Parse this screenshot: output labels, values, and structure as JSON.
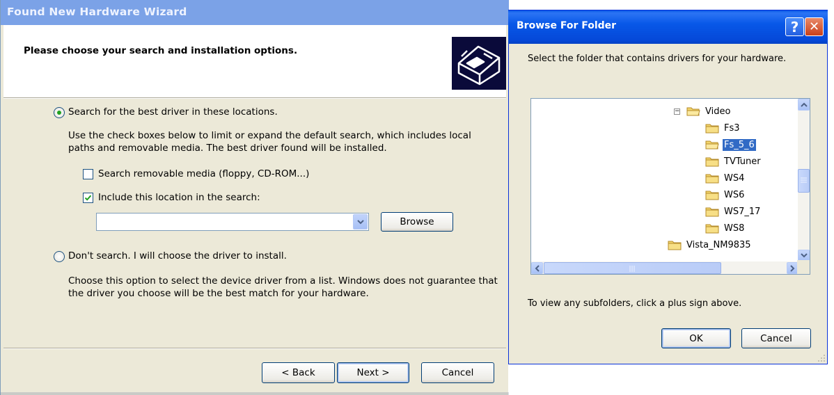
{
  "wizard": {
    "title": "Found New Hardware Wizard",
    "heading": "Please choose your search and installation options.",
    "option_search": {
      "label": "Search for the best driver in these locations.",
      "checked": true,
      "description": "Use the check boxes below to limit or expand the default search, which includes local paths and removable media. The best driver found will be installed.",
      "removable_media": {
        "label": "Search removable media (floppy, CD-ROM...)",
        "checked": false
      },
      "include_location": {
        "label": "Include this location in the search:",
        "checked": true
      },
      "location_value": "",
      "browse_label": "Browse"
    },
    "option_dont_search": {
      "label": "Don't search. I will choose the driver to install.",
      "checked": false,
      "description": "Choose this option to select the device driver from a list.  Windows does not guarantee that the driver you choose will be the best match for your hardware."
    },
    "buttons": {
      "back": "< Back",
      "next": "Next >",
      "cancel": "Cancel"
    }
  },
  "browse": {
    "title": "Browse For Folder",
    "help_glyph": "?",
    "close_glyph": "✕",
    "prompt": "Select the folder that contains drivers for your hardware.",
    "tree": {
      "parent": {
        "label": "Video",
        "expander": "−"
      },
      "children": [
        "Fs3",
        "Fs_5_6",
        "TVTuner",
        "WS4",
        "WS6",
        "WS7_17",
        "WS8"
      ],
      "selected": "Fs_5_6",
      "sibling": "Vista_NM9835"
    },
    "hint": "To view any subfolders, click a plus sign above.",
    "ok_label": "OK",
    "cancel_label": "Cancel"
  },
  "colors": {
    "wizard_titlebar": "#7ba2e7",
    "browse_titlebar": "#0858e8",
    "dialog_face": "#ece9d8",
    "selection": "#316ac5",
    "folder_yellow": "#f3d56c"
  }
}
